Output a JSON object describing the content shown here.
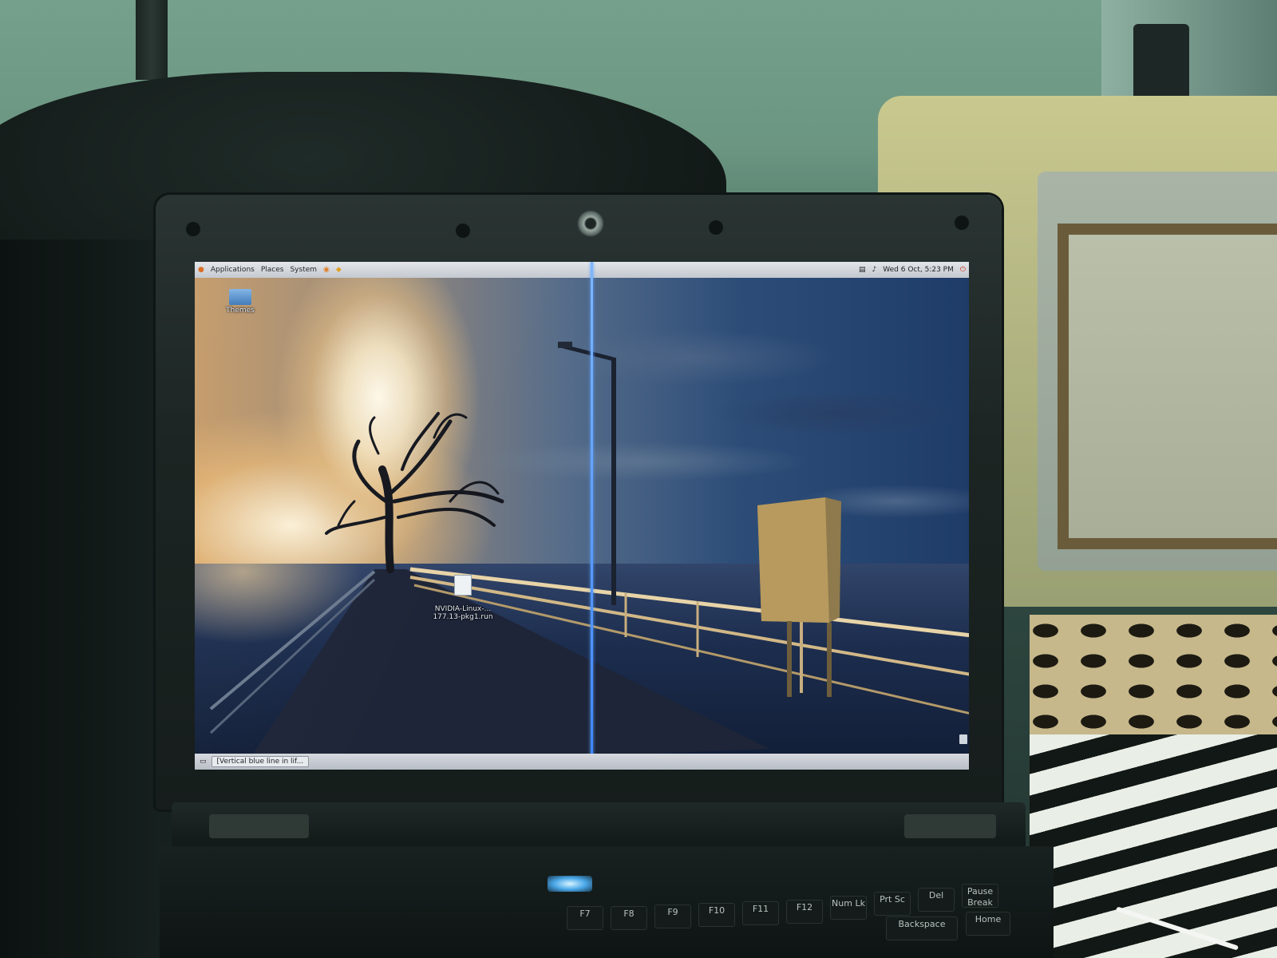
{
  "scene": {
    "description_colors": {
      "wall": "#6b9682",
      "laptop_bezel": "#1c2523",
      "blue_line": "#3c86ff"
    }
  },
  "top_panel": {
    "menus": [
      "Applications",
      "Places",
      "System"
    ],
    "clock": "Wed 6 Oct, 5:23 PM",
    "icons": [
      "ubuntu-logo-icon",
      "firefox-icon",
      "help-icon",
      "network-icon",
      "volume-icon",
      "shutdown-icon"
    ]
  },
  "desktop": {
    "icons": [
      {
        "label": "Themes",
        "icon": "folder-icon"
      },
      {
        "label": "NVIDIA-Linux-...\n177.13-pkg1.run",
        "icon": "file-icon"
      }
    ]
  },
  "bottom_panel": {
    "task_button": "[Vertical blue line in lif..."
  },
  "keyboard": {
    "keys": [
      "F7",
      "F8",
      "F9",
      "F10",
      "F11",
      "F12",
      "Num Lk",
      "Prt Sc",
      "Del",
      "Pause Break",
      "Backspace",
      "Home"
    ]
  }
}
